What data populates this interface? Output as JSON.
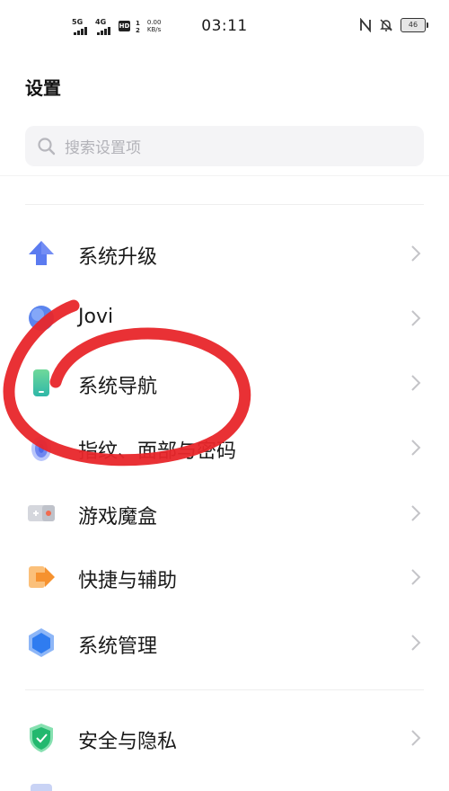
{
  "status_bar": {
    "sim1_network": "5G",
    "sim2_network": "4G",
    "hd_label": "HD",
    "hd_numbers": "1\n2",
    "speed_value": "0.00",
    "speed_unit": "KB/s",
    "time": "03:11",
    "battery": "46"
  },
  "header": {
    "title": "设置"
  },
  "search": {
    "placeholder": "搜索设置项"
  },
  "settings_items": [
    {
      "label": "系统升级",
      "icon": "upgrade-arrow-icon"
    },
    {
      "label": "Jovi",
      "icon": "jovi-icon"
    },
    {
      "label": "系统导航",
      "icon": "phone-navigation-icon"
    },
    {
      "label": "指纹、面部与密码",
      "icon": "fingerprint-icon"
    },
    {
      "label": "游戏魔盒",
      "icon": "game-box-icon"
    },
    {
      "label": "快捷与辅助",
      "icon": "shortcut-arrow-icon"
    },
    {
      "label": "系统管理",
      "icon": "hexagon-icon"
    },
    {
      "label": "安全与隐私",
      "icon": "shield-icon"
    }
  ],
  "colors": {
    "accent_blue": "#5B7BF0",
    "scribble_red": "#E8262A",
    "nav_green": "#3DC47E"
  }
}
